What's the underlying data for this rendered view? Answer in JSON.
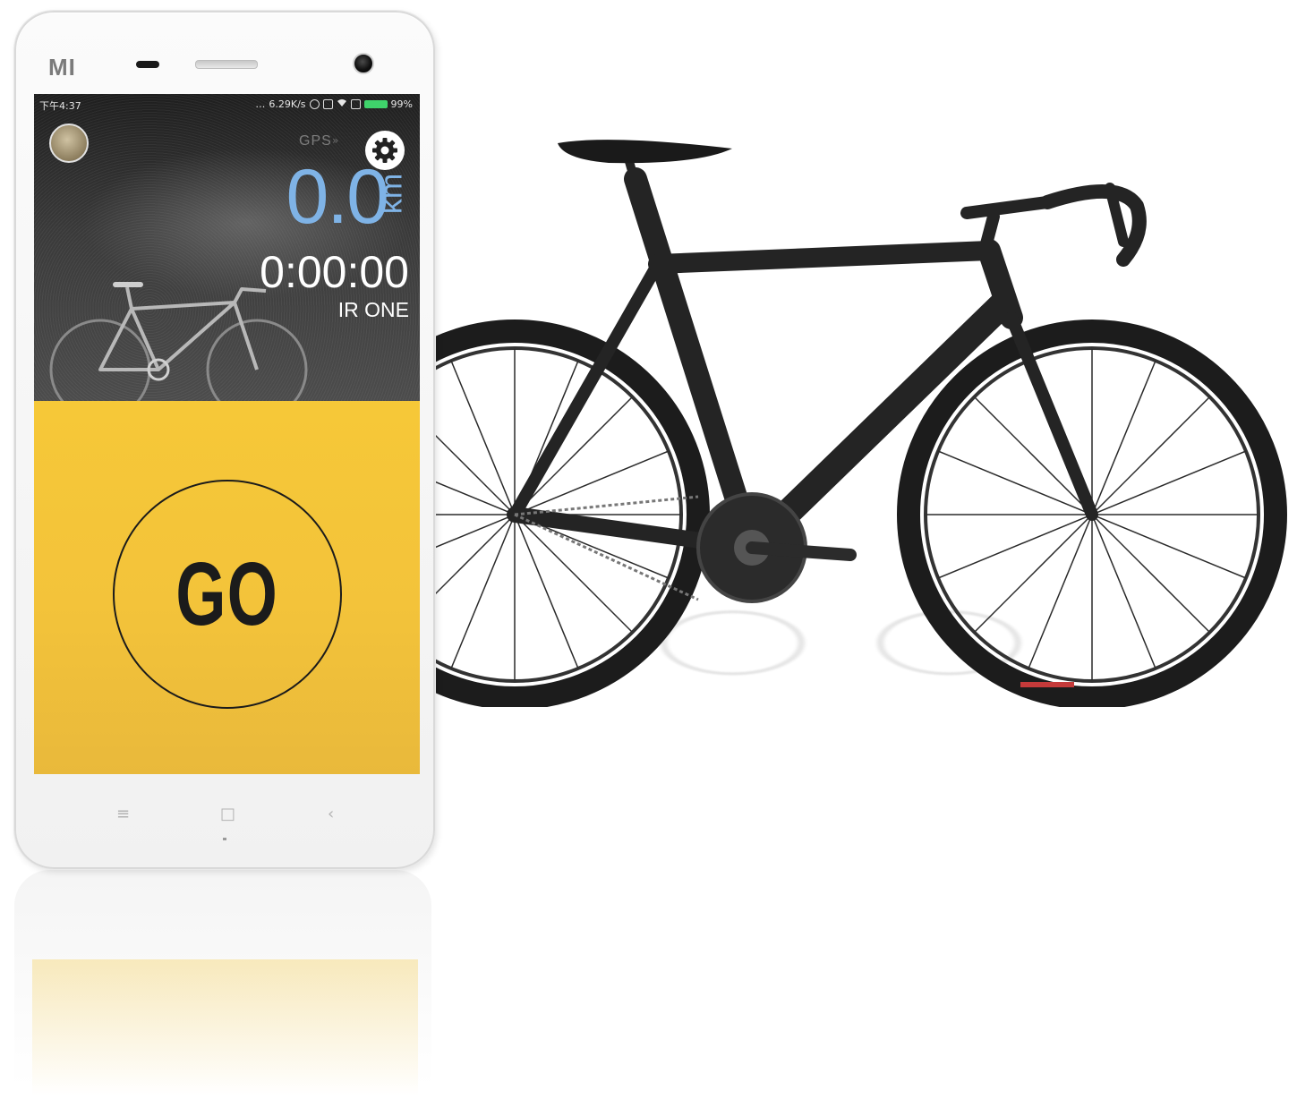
{
  "device": {
    "brand": "MI"
  },
  "status_bar": {
    "time": "下午4:37",
    "network_speed": "6.29K/s",
    "battery_percent": "99%"
  },
  "header": {
    "gps_label": "GPS",
    "gps_signal": "»"
  },
  "ride": {
    "distance": "0.0",
    "distance_unit": "km",
    "duration": "0:00:00",
    "bike_name": "IR ONE"
  },
  "action": {
    "go_label": "GO"
  },
  "nav": {
    "menu": "≡",
    "home": "□",
    "back": "‹"
  },
  "colors": {
    "accent_blue": "#7fb3e6",
    "yellow": "#f3c33a",
    "battery_green": "#3fd36b"
  },
  "icons": {
    "settings": "gear-icon",
    "avatar": "bike-avatar-icon",
    "battery": "battery-icon",
    "wifi": "wifi-icon"
  }
}
